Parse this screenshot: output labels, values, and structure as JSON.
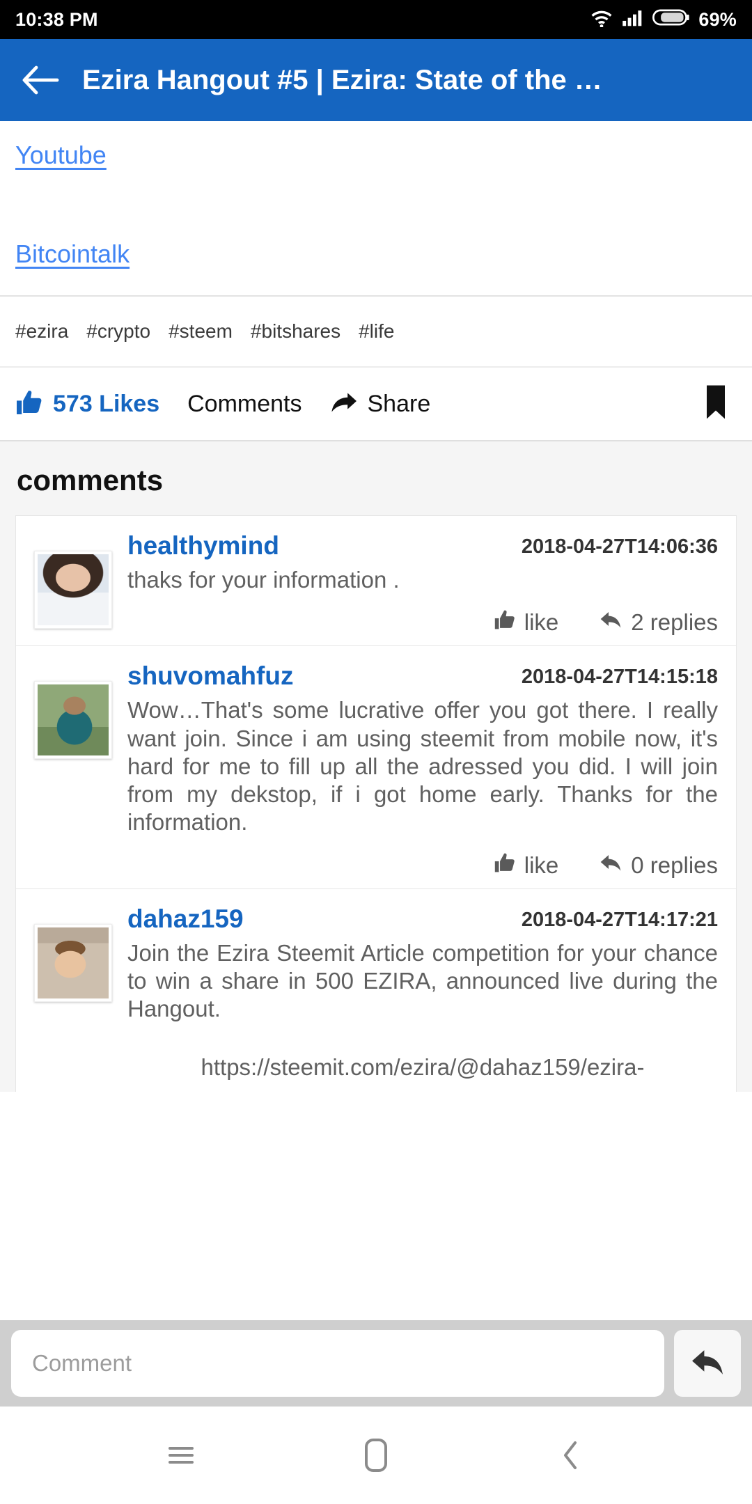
{
  "status_bar": {
    "time": "10:38 PM",
    "battery_percent": "69%",
    "icons": [
      "wifi-icon",
      "signal-icon",
      "battery-icon"
    ]
  },
  "app_bar": {
    "back_icon": "back-arrow-icon",
    "title": "Ezira Hangout #5 | Ezira: State of the …",
    "background_color": "#1565c0"
  },
  "article": {
    "links": [
      {
        "label": "Youtube"
      },
      {
        "label": "Bitcointalk"
      }
    ],
    "tags": [
      "#ezira",
      "#crypto",
      "#steem",
      "#bitshares",
      "#life"
    ]
  },
  "action_bar": {
    "like_icon": "thumbs-up-icon",
    "likes_label": "573 Likes",
    "comments_label": "Comments",
    "share_icon": "share-arrow-icon",
    "share_label": "Share",
    "bookmark_icon": "bookmark-icon",
    "accent_color": "#1565c0"
  },
  "comments_section": {
    "heading": "comments",
    "comments": [
      {
        "avatar": "avatar-healthymind",
        "username": "healthymind",
        "timestamp": "2018-04-27T14:06:36",
        "body": "thaks for your information .",
        "like_icon": "thumbs-up-icon",
        "like_label": "like",
        "reply_icon": "reply-arrow-icon",
        "replies_label": "2 replies"
      },
      {
        "avatar": "avatar-shuvomahfuz",
        "username": "shuvomahfuz",
        "timestamp": "2018-04-27T14:15:18",
        "body": "Wow…That's some lucrative offer you got there. I really want join. Since i am using steemit from mobile now, it's hard for me to fill up all the adressed you did. I will join from my dekstop, if i got home early. Thanks for the information.",
        "like_icon": "thumbs-up-icon",
        "like_label": "like",
        "reply_icon": "reply-arrow-icon",
        "replies_label": "0 replies"
      },
      {
        "avatar": "avatar-dahaz159",
        "username": "dahaz159",
        "timestamp": "2018-04-27T14:17:21",
        "body": "Join the Ezira Steemit Article competition for your chance to win a share in 500 EZIRA, announced live during the Hangout.",
        "body_url": "https://steemit.com/ezira/@dahaz159/ezira-"
      }
    ]
  },
  "composer": {
    "placeholder": "Comment",
    "value": "",
    "send_icon": "reply-send-icon"
  },
  "nav_bar": {
    "menu_icon": "menu-icon",
    "home_icon": "home-icon",
    "back_icon": "back-chevron-icon"
  }
}
